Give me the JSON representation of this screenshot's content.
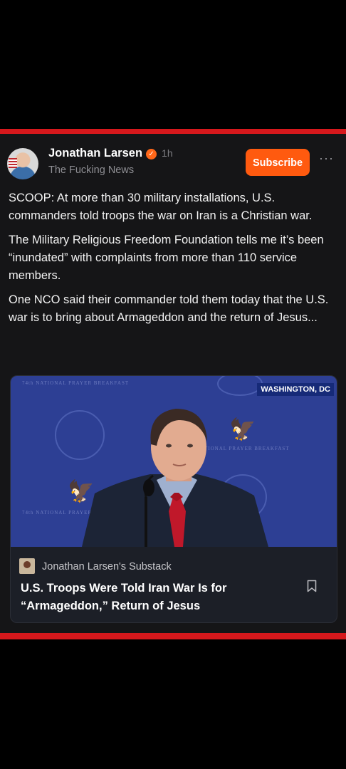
{
  "post": {
    "author": "Jonathan Larsen",
    "time": "1h",
    "publication": "The Fucking News",
    "subscribe_label": "Subscribe",
    "more_label": "···",
    "paragraphs": [
      "SCOOP: At more than 30 military installations, U.S. commanders told troops the war on Iran is a Christian war.",
      "The Military Religious Freedom Foundation tells me it’s been “inundated” with complaints from more than 110 service members.",
      "One NCO said their commander told them today that the U.S. war is to bring about Armageddon and the return of Jesus..."
    ]
  },
  "card": {
    "image_label": "WASHINGTON, DC",
    "background_text_1": "74th NATIONAL PRAYER BREAKFAST",
    "background_text_2": "TIONAL PRAYER BREAKFAST",
    "background_text_3": "74th NATIONAL PRAYER",
    "source": "Jonathan Larsen's Substack",
    "title": "U.S. Troops Were Told Iran War Is for “Armageddon,” Return of Jesus"
  },
  "colors": {
    "accent": "#ff5a0f",
    "frame_red": "#d6181c",
    "background": "#151517"
  }
}
